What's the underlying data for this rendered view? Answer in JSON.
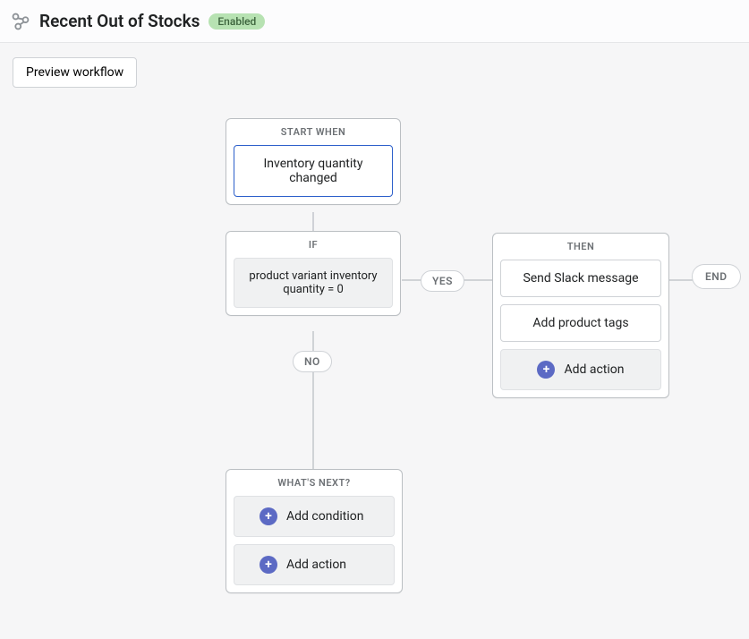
{
  "header": {
    "title": "Recent Out of Stocks",
    "status_badge": "Enabled"
  },
  "buttons": {
    "preview": "Preview workflow"
  },
  "cards": {
    "start": {
      "label": "START WHEN",
      "trigger": "Inventory quantity changed"
    },
    "if": {
      "label": "IF",
      "condition": "product variant inventory quantity = 0"
    },
    "then": {
      "label": "THEN",
      "actions": [
        "Send Slack message",
        "Add product tags"
      ],
      "add_action": "Add action"
    },
    "next": {
      "label": "WHAT'S NEXT?",
      "add_condition": "Add condition",
      "add_action": "Add action"
    }
  },
  "pills": {
    "yes": "YES",
    "no": "NO",
    "end": "END"
  }
}
